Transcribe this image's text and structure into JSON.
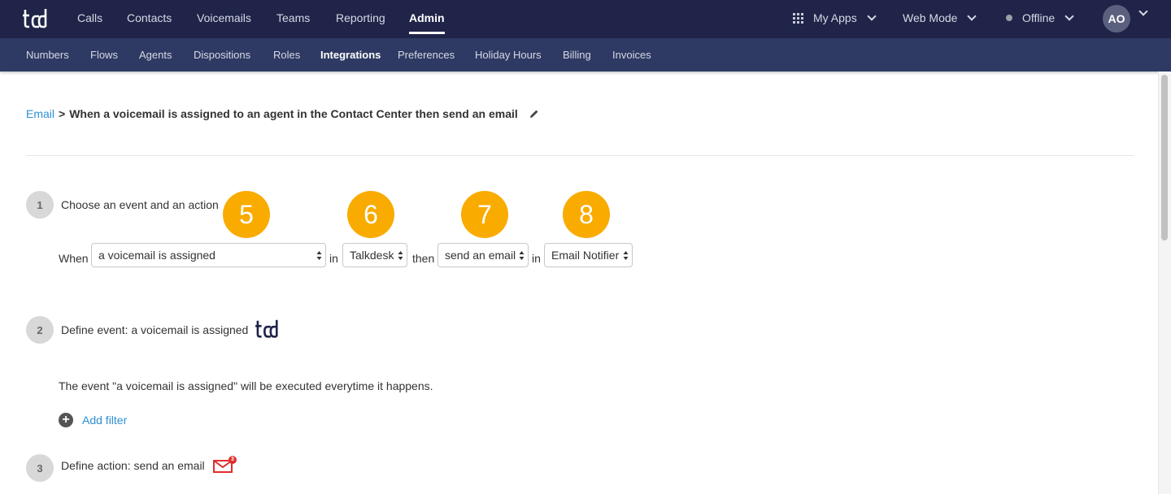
{
  "topnav": {
    "items": [
      "Calls",
      "Contacts",
      "Voicemails",
      "Teams",
      "Reporting",
      "Admin"
    ],
    "active": "Admin",
    "my_apps": "My Apps",
    "mode": "Web Mode",
    "status": "Offline",
    "avatar_initials": "AO"
  },
  "subnav": {
    "items": [
      "Numbers",
      "Flows",
      "Agents",
      "Dispositions",
      "Roles",
      "Integrations",
      "Preferences",
      "Holiday Hours",
      "Billing",
      "Invoices"
    ],
    "active": "Integrations"
  },
  "breadcrumb": {
    "link": "Email",
    "separator": ">",
    "title": "When a voicemail is assigned to an agent in the Contact Center then send an email"
  },
  "step1": {
    "number": "1",
    "title": "Choose an event and an action",
    "when_label": "When",
    "event_value": "a voicemail is assigned",
    "in_label": "in",
    "event_app_value": "Talkdesk",
    "then_label": "then",
    "action_value": "send an email",
    "in_label_2": "in",
    "action_app_value": "Email Notifier",
    "badges": [
      "5",
      "6",
      "7",
      "8"
    ]
  },
  "step2": {
    "number": "2",
    "title": "Define event: a voicemail is assigned",
    "description": "The event \"a voicemail is assigned\" will be executed everytime it happens.",
    "add_filter": "Add filter"
  },
  "step3": {
    "number": "3",
    "title": "Define action: send an email",
    "email_icon_count": "3"
  },
  "colors": {
    "topbar": "#1f2448",
    "subbar": "#2e3a63",
    "link": "#2d8fd5",
    "badge": "#f9ab00",
    "email_icon": "#e02d2d"
  }
}
